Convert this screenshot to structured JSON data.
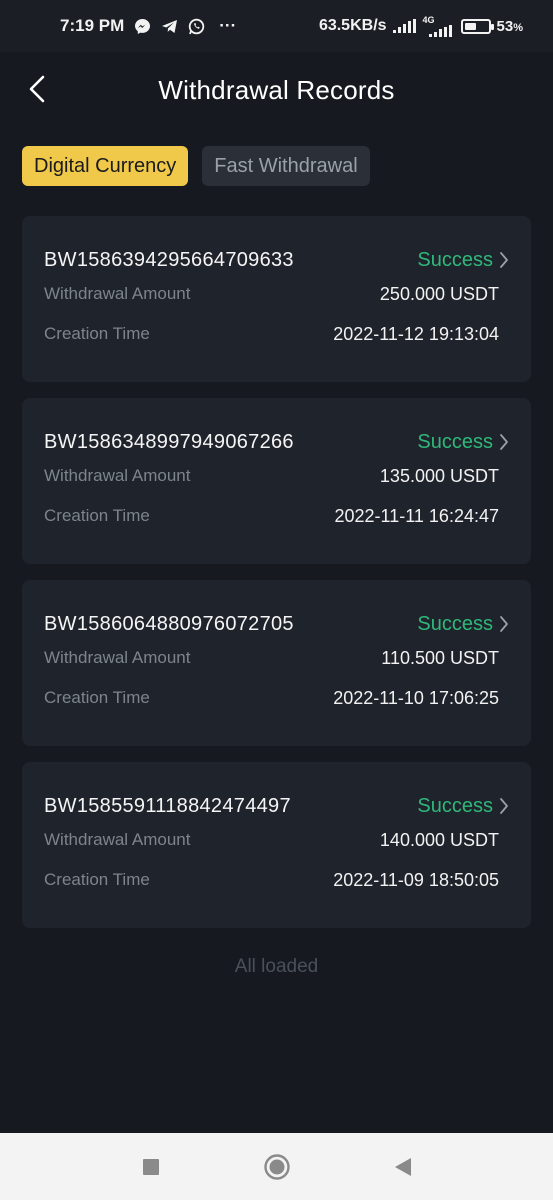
{
  "status_bar": {
    "time": "7:19 PM",
    "notif_icons": [
      "messenger-icon",
      "telegram-icon",
      "whatsapp-icon"
    ],
    "more": "···",
    "net_speed": "63.5KB/s",
    "network_type": "4G",
    "battery_percent": 53,
    "battery_label": "53",
    "battery_unit": "%"
  },
  "header": {
    "title": "Withdrawal Records"
  },
  "tabs": [
    {
      "label": "Digital Currency",
      "active": true
    },
    {
      "label": "Fast Withdrawal",
      "active": false
    }
  ],
  "labels": {
    "amount": "Withdrawal Amount",
    "time": "Creation Time"
  },
  "records": [
    {
      "id": "BW1586394295664709633",
      "status": "Success",
      "amount": "250.000 USDT",
      "created": "2022-11-12 19:13:04"
    },
    {
      "id": "BW1586348997949067266",
      "status": "Success",
      "amount": "135.000 USDT",
      "created": "2022-11-11 16:24:47"
    },
    {
      "id": "BW1586064880976072705",
      "status": "Success",
      "amount": "110.500 USDT",
      "created": "2022-11-10 17:06:25"
    },
    {
      "id": "BW1585591118842474497",
      "status": "Success",
      "amount": "140.000 USDT",
      "created": "2022-11-09 18:50:05"
    }
  ],
  "footer_text": "All loaded",
  "colors": {
    "background": "#161a20",
    "card": "#1f232b",
    "accent": "#f0c94a",
    "success": "#2fb87a"
  }
}
